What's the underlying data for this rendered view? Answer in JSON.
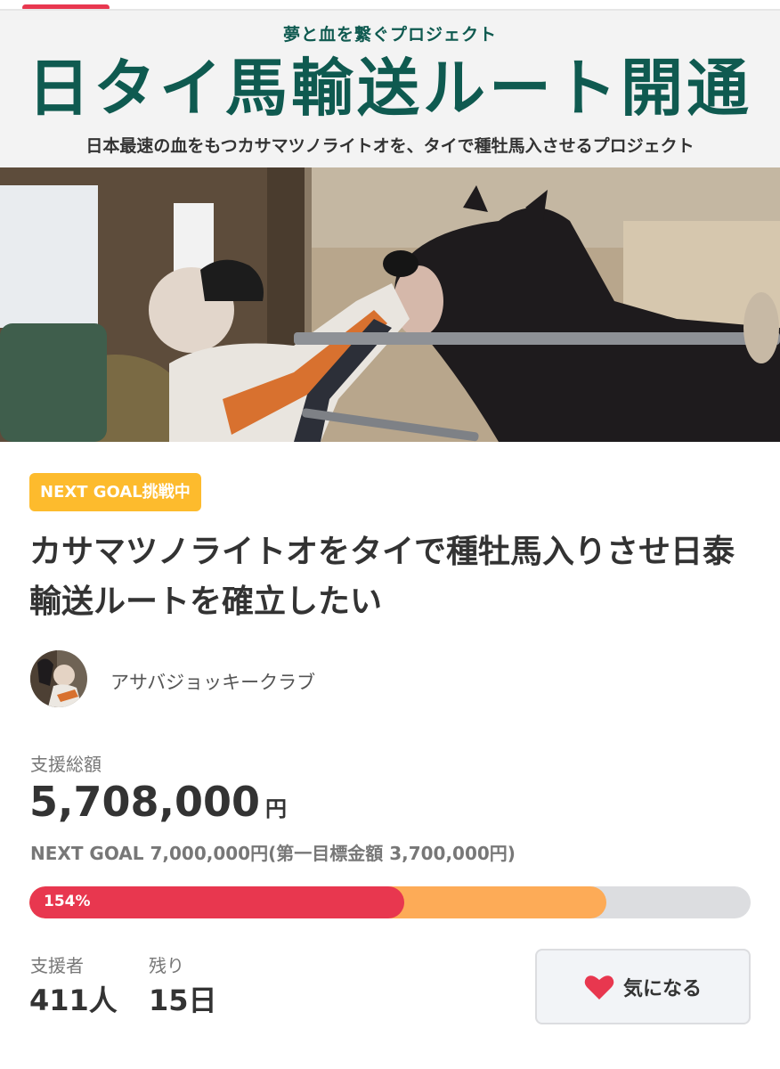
{
  "banner": {
    "kicker": "夢と血を繋ぐプロジェクト",
    "title": "日タイ馬輸送ルート開通",
    "subtitle": "日本最速の血をもつカサマツノライトオを、タイで種牡馬入させるプロジェクト"
  },
  "project": {
    "badge": "NEXT GOAL挑戦中",
    "title": "カサマツノライトオをタイで種牡馬入りさせ日泰輸送ルートを確立したい",
    "owner": "アサバジョッキークラブ"
  },
  "funding": {
    "total_label": "支援総額",
    "amount": "5,708,000",
    "unit": "円",
    "next_goal": "NEXT GOAL 7,000,000円(第一目標金額 3,700,000円)",
    "progress_label": "154%",
    "progress_fraction_red": 0.52,
    "progress_fraction_orange": 0.8
  },
  "stats": {
    "supporters_label": "支援者",
    "supporters_value": "411人",
    "remaining_label": "残り",
    "remaining_value": "15日"
  },
  "actions": {
    "favorite_label": "気になる"
  },
  "colors": {
    "accent_red": "#e8374f",
    "badge_yellow": "#fdbb2d",
    "banner_green": "#0f5a50",
    "progress_orange": "#fdab57"
  },
  "icons": {
    "favorite": "heart-icon"
  }
}
